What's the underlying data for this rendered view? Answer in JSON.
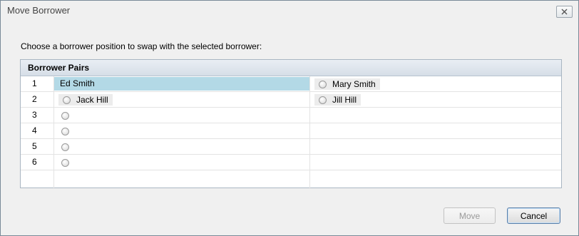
{
  "window": {
    "title": "Move Borrower",
    "close_icon": "close-icon"
  },
  "instruction": "Choose a borrower position to swap with the selected borrower:",
  "panel": {
    "header": "Borrower Pairs",
    "rows": [
      {
        "num": "1",
        "a": {
          "type": "selected",
          "label": "Ed Smith"
        },
        "b": {
          "type": "radio",
          "label": "Mary Smith",
          "checked": false
        }
      },
      {
        "num": "2",
        "a": {
          "type": "radio",
          "label": "Jack Hill",
          "checked": false
        },
        "b": {
          "type": "radio",
          "label": "Jill Hill",
          "checked": false
        }
      },
      {
        "num": "3",
        "a": {
          "type": "radio",
          "label": "",
          "checked": false
        },
        "b": null
      },
      {
        "num": "4",
        "a": {
          "type": "radio",
          "label": "",
          "checked": false
        },
        "b": null
      },
      {
        "num": "5",
        "a": {
          "type": "radio",
          "label": "",
          "checked": false
        },
        "b": null
      },
      {
        "num": "6",
        "a": {
          "type": "radio",
          "label": "",
          "checked": false
        },
        "b": null
      }
    ]
  },
  "buttons": {
    "move": {
      "label": "Move",
      "enabled": false
    },
    "cancel": {
      "label": "Cancel",
      "enabled": true
    }
  },
  "colors": {
    "selected_row": "#b3d9e6",
    "panel_header": "#dfe6ee"
  }
}
